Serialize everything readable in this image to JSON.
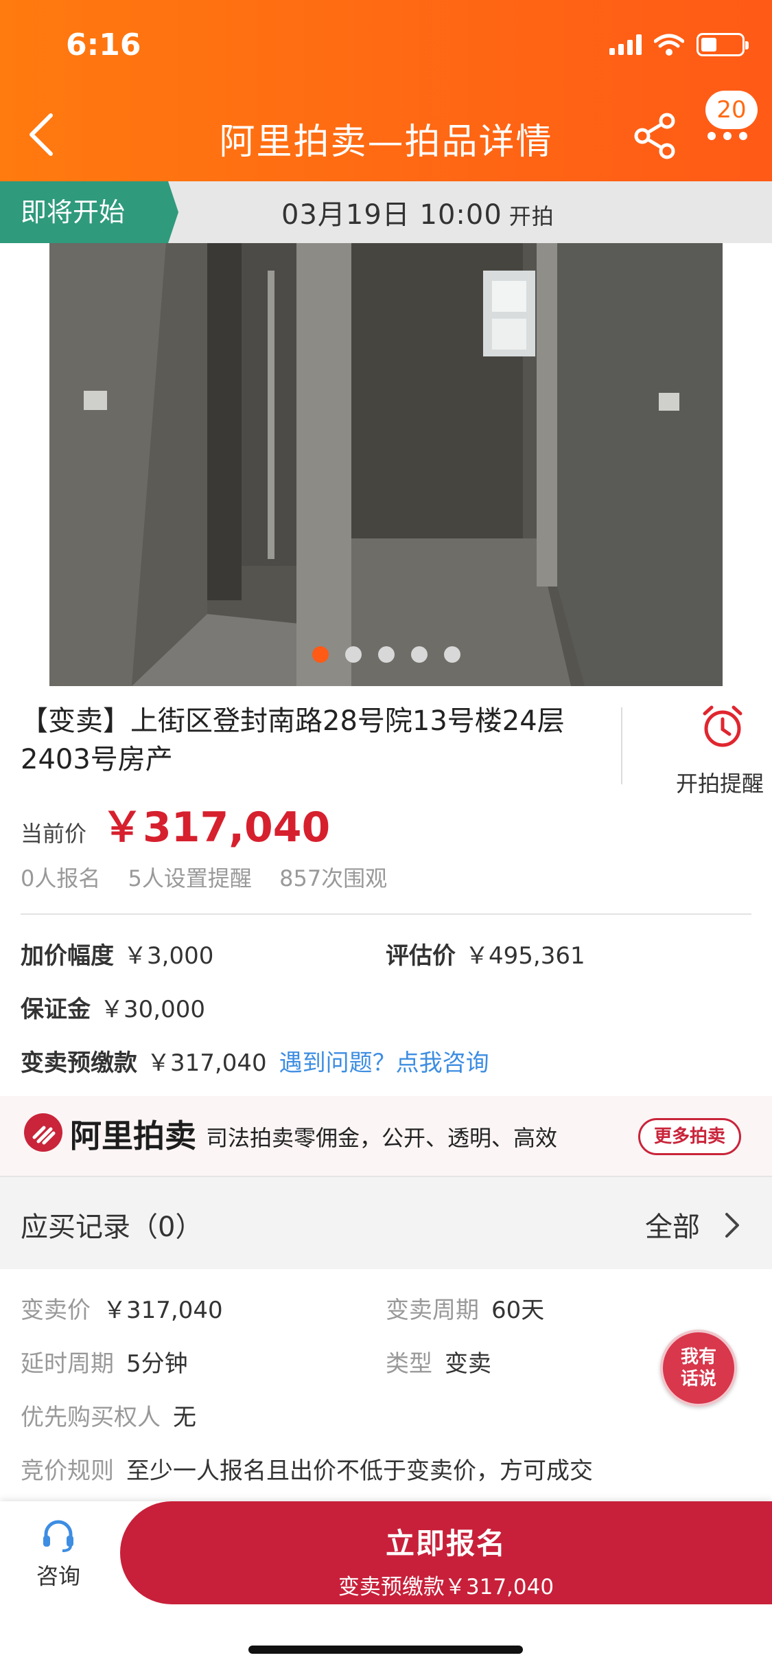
{
  "status_bar": {
    "time": "6:16"
  },
  "nav": {
    "title": "阿里拍卖—拍品详情",
    "badge_count": "20"
  },
  "auction_strip": {
    "tag": "即将开始",
    "datetime": "03月19日 10:00",
    "suffix": "开拍"
  },
  "gallery": {
    "slide_count": 5,
    "active_index": 0
  },
  "item": {
    "title": "【变卖】上街区登封南路28号院13号楼24层2403号房产",
    "reminder_label": "开拍提醒",
    "current_price_label": "当前价",
    "current_price": "￥317,040",
    "stats": {
      "signups": "0人报名",
      "reminders": "5人设置提醒",
      "views": "857次围观"
    }
  },
  "info": {
    "increment_label": "加价幅度",
    "increment_value": "￥3,000",
    "appraisal_label": "评估价",
    "appraisal_value": "￥495,361",
    "deposit_label": "保证金",
    "deposit_value": "￥30,000",
    "prepay_label": "变卖预缴款",
    "prepay_value": "￥317,040",
    "help_link": "遇到问题？点我咨询"
  },
  "banner": {
    "brand": "阿里拍卖",
    "slogan": "司法拍卖零佣金，公开、透明、高效",
    "more_button": "更多拍卖"
  },
  "records": {
    "title": "应买记录（0）",
    "all_label": "全部"
  },
  "details": {
    "sell_price_label": "变卖价",
    "sell_price_value": "￥317,040",
    "sell_period_label": "变卖周期",
    "sell_period_value": "60天",
    "delay_label": "延时周期",
    "delay_value": "5分钟",
    "type_label": "类型",
    "type_value": "变卖",
    "priority_label": "优先购买权人",
    "priority_value": "无",
    "rule_label": "竞价规则",
    "rule_value": "至少一人报名且出价不低于变卖价，方可成交"
  },
  "talk_button": {
    "line1": "我有",
    "line2": "话说"
  },
  "bottom_bar": {
    "consult_label": "咨询",
    "signup_label": "立即报名",
    "signup_sub": "变卖预缴款￥317,040"
  },
  "colors": {
    "header_orange": "#ff6a13",
    "price_red": "#d6202e",
    "tag_green": "#2f9a7c",
    "link_blue": "#3d8de2",
    "cta_red": "#c8203a"
  },
  "icons": {
    "back": "chevron-left-icon",
    "share": "share-icon",
    "more": "more-dots-icon",
    "reminder": "alarm-clock-icon",
    "consult": "headset-icon",
    "records": "chevron-right-icon"
  }
}
